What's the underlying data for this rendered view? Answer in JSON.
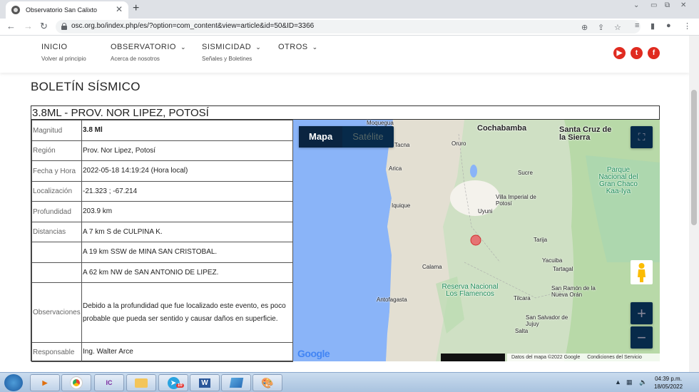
{
  "browser": {
    "tab_title": "Observatorio San Calixto",
    "url": "osc.org.bo/index.php/es/?option=com_content&view=article&id=50&ID=3366"
  },
  "site_nav": [
    {
      "label": "INICIO",
      "sub": "Volver al principio",
      "caret": false
    },
    {
      "label": "OBSERVATORIO",
      "sub": "Acerca de nosotros",
      "caret": true
    },
    {
      "label": "SISMICIDAD",
      "sub": "Señales y Boletines",
      "caret": true
    },
    {
      "label": "OTROS",
      "sub": "",
      "caret": true
    }
  ],
  "social_icons": [
    "youtube-icon",
    "twitter-icon",
    "facebook-icon"
  ],
  "page_title": "BOLETÍN SÍSMICO",
  "bulletin": {
    "heading": "3.8ML - PROV. NOR LIPEZ, POTOSÍ",
    "rows": [
      {
        "key": "Magnitud",
        "value": "3.8 Ml"
      },
      {
        "key": "Región",
        "value": "Prov. Nor Lipez, Potosí"
      },
      {
        "key": "Fecha y Hora",
        "value": "2022-05-18 14:19:24 (Hora local)"
      },
      {
        "key": "Localización",
        "value": "-21.323 ; -67.214"
      },
      {
        "key": "Profundidad",
        "value": "203.9 km"
      },
      {
        "key": "Distancias",
        "value": "A 7 km S de CULPINA K."
      },
      {
        "key": "",
        "value": "A 19 km SSW de MINA SAN CRISTOBAL."
      },
      {
        "key": "",
        "value": "A 62 km NW de SAN ANTONIO DE LIPEZ."
      },
      {
        "key": "Observaciones",
        "value": "Debido a la profundidad que fue localizado este evento, es poco probable que pueda ser sentido y causar daños en superficie."
      },
      {
        "key": "Responsable",
        "value": "Ing. Walter Arce"
      }
    ]
  },
  "map": {
    "type_map": "Mapa",
    "type_satellite": "Satélite",
    "logo": "Google",
    "copyright": "Datos del mapa ©2022 Google",
    "terms": "Condiciones del Servicio",
    "zoom_in": "+",
    "zoom_out": "−",
    "labels": {
      "moquegua": "Moquegua",
      "cochabamba": "Cochabamba",
      "santa_cruz": "Santa Cruz de la Sierra",
      "tacna": "Tacna",
      "oruro": "Oruro",
      "arica": "Arica",
      "sucre": "Sucre",
      "parque": "Parque Nacional del Gran Chaco Kaa-Iya",
      "iquique": "Iquique",
      "villa_imperial": "Villa Imperial de Potosí",
      "uyuni": "Uyuni",
      "tarija": "Tarija",
      "calama": "Calama",
      "yacuiba": "Yacuiba",
      "tartagal": "Tartagal",
      "reserva": "Reserva Nacional Los Flamencos",
      "antofagasta": "Antofagasta",
      "tilcara": "Tilcara",
      "san_ramon": "San Ramón de la Nueva Orán",
      "san_salvador": "San Salvador de Jujuy",
      "salta": "Salta"
    }
  },
  "taskbar": {
    "clock_time": "04:39 p.m.",
    "clock_date": "18/05/2022",
    "apps": [
      "media-player-icon",
      "chrome-icon",
      "ic-app-icon",
      "file-explorer-icon",
      "telegram-icon",
      "word-icon",
      "app-icon",
      "paint-icon"
    ],
    "badge": "10",
    "ic_label": "IC",
    "word_label": "W"
  }
}
